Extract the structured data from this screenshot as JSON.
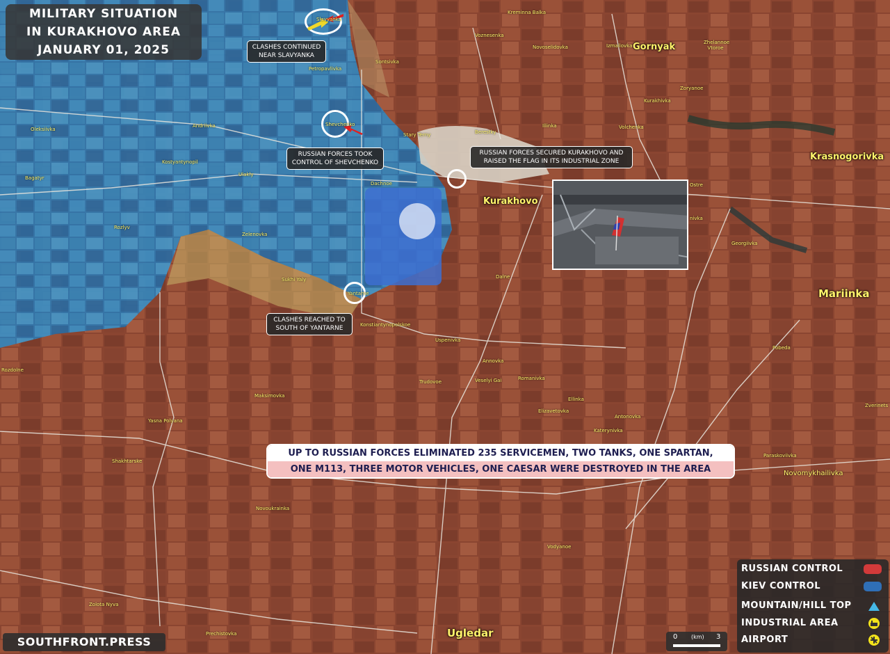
{
  "title": {
    "line1": "MILITARY SITUATION",
    "line2": "IN KURAKHOVO AREA",
    "line3": "JANUARY 01, 2025"
  },
  "callouts": {
    "slavyanka": [
      "CLASHES CONTINUED",
      "NEAR SLAVYANKA"
    ],
    "shevchenko": [
      "RUSSIAN FORCES TOOK",
      "CONTROL OF SHEVCHENKO"
    ],
    "kurakhovo": [
      "RUSSIAN FORCES SECURED KURAKHOVO AND",
      "RAISED THE FLAG IN ITS INDUSTRIAL ZONE"
    ],
    "yantarne": [
      "CLASHES REACHED TO",
      "SOUTH OF YANTARNE"
    ]
  },
  "banner": {
    "line1": "UP TO RUSSIAN FORCES ELIMINATED 235 SERVICEMEN, TWO TANKS, ONE SPARTAN,",
    "line2": "ONE M113, THREE MOTOR VEHICLES, ONE CAESAR WERE DESTROYED IN THE AREA"
  },
  "major_towns": {
    "gornyak": "Gornyak",
    "kurakhovo": "Kurakhovo",
    "krasnogorivka": "Krasnogorivka",
    "mariinka": "Mariinka",
    "ugledar": "Ugledar"
  },
  "towns": {
    "slavyanka": "Slavyanka",
    "kreminna_balka": "Kreminna Balka",
    "voznesenka": "Voznesenka",
    "novoselidovka": "Novoselidovka",
    "izmailovka": "Izmailovka",
    "zhelannoe_vtoroe": "Zhelannoe Vtoroe",
    "sontsivka": "Sontsivka",
    "petropavlivka": "Petropavlivka",
    "zoryanoe": "Zoryanoe",
    "kurakhivka": "Kurakhivka",
    "oleksiivka": "Oleksiivka",
    "andriivka": "Andriivka",
    "shevchenko": "Shevchenko",
    "stary_terny": "Stary Terny",
    "berestky": "Berestky",
    "illinka_n": "Illinka",
    "volchenka": "Volchenka",
    "bagatyr": "Bagatyr",
    "kostyantynopil": "Kostyantynopil",
    "ulakly": "Ulakly",
    "dachnoe": "Dachnoe",
    "ostrovske": "Ostre",
    "rozlyv": "Rozlyv",
    "zelenovka": "Zelenovka",
    "maksymilianivka": "nivka",
    "georgiivka": "Georgiivka",
    "sukhi_yaly": "Sukhi Yaly",
    "yantarne": "Yantarne",
    "dalne": "Dalne",
    "konstiantynopolskoe": "Konstiantynopolskoe",
    "uspenivka": "Uspenivka",
    "rozdolne": "Rozdolne",
    "annovka": "Annovka",
    "pobeda": "Pobeda",
    "trudovoe": "Trudovoe",
    "veselyi_gai": "Veselyi Gai",
    "romanivka": "Romanivka",
    "maksimovka": "Maksimovka",
    "ellinka": "Ellinka",
    "zverinets": "Zverinets",
    "yasna_polyana": "Yasna Polyana",
    "elizavetovka": "Elizavetovka",
    "antonovka": "Antonovka",
    "katerynivka": "Katerynivka",
    "shakhtarske": "Shakhtarske",
    "paraskoviivka": "Paraskoviivka",
    "novomykhailivka": "Novomykhailivka",
    "novoukrainka": "Novoukrainka",
    "vodyanoe": "Vodyanoe",
    "zolota_nyva": "Zolota Nyva",
    "prechistovka": "Prechistovka"
  },
  "legend": {
    "russian": "RUSSIAN CONTROL",
    "kiev": "KIEV CONTROL",
    "mountain": "MOUNTAIN/HILL TOP",
    "industrial": "INDUSTRIAL AREA",
    "airport": "AIRPORT"
  },
  "colors": {
    "russian": "#d23a3a",
    "kiev": "#2f6fb6",
    "mountain": "#45b8e6",
    "industrial": "#f2e21c",
    "label": "#fff36b"
  },
  "icons": [
    "triangle-icon",
    "industrial-icon",
    "airport-icon",
    "arrow-icon"
  ],
  "brand": "SOUTHFRONT.PRESS",
  "scale": {
    "start": "0",
    "unit": "(km)",
    "end": "3"
  }
}
